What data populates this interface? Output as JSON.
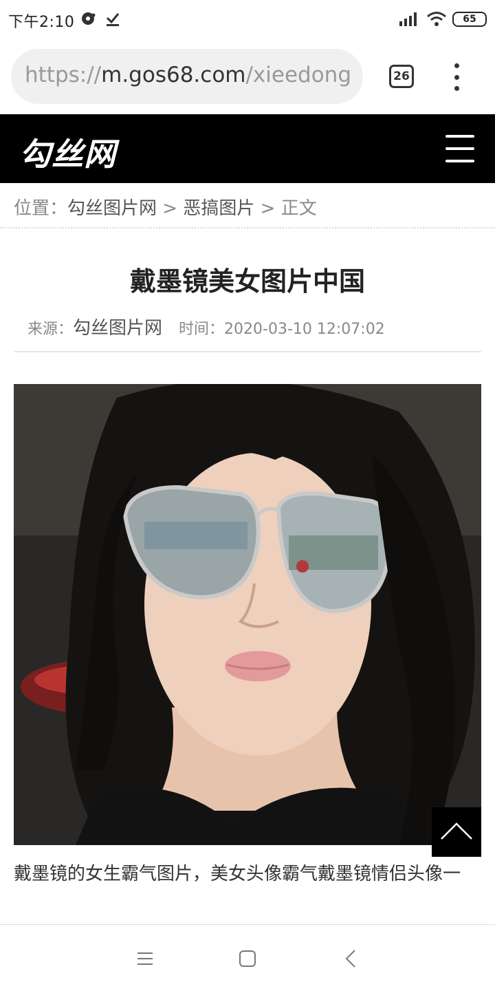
{
  "status_bar": {
    "time": "下午2:10",
    "battery": "65",
    "icons": [
      "notification-icon",
      "download-done-icon",
      "signal-icon",
      "wifi-icon",
      "battery-icon"
    ]
  },
  "browser": {
    "url_scheme": "https://",
    "url_host": "m.gos68.com",
    "url_path": "/xieedong",
    "tab_count": "26"
  },
  "site": {
    "logo": "勾丝网"
  },
  "breadcrumb": {
    "prefix": "位置：",
    "home": "勾丝图片网",
    "sep1": " > ",
    "category": "恶搞图片",
    "sep2": " > ",
    "current": "正文"
  },
  "article": {
    "title": "戴墨镜美女图片中国",
    "source_label": "来源：",
    "source": "勾丝图片网",
    "time_label": "时间：",
    "time": "2020-03-10 12:07:02",
    "caption": "戴墨镜的女生霸气图片，美女头像霸气戴墨镜情侣头像一"
  },
  "colors": {
    "header_bg": "#000000",
    "accent_text": "#333333",
    "muted_text": "#888888"
  }
}
